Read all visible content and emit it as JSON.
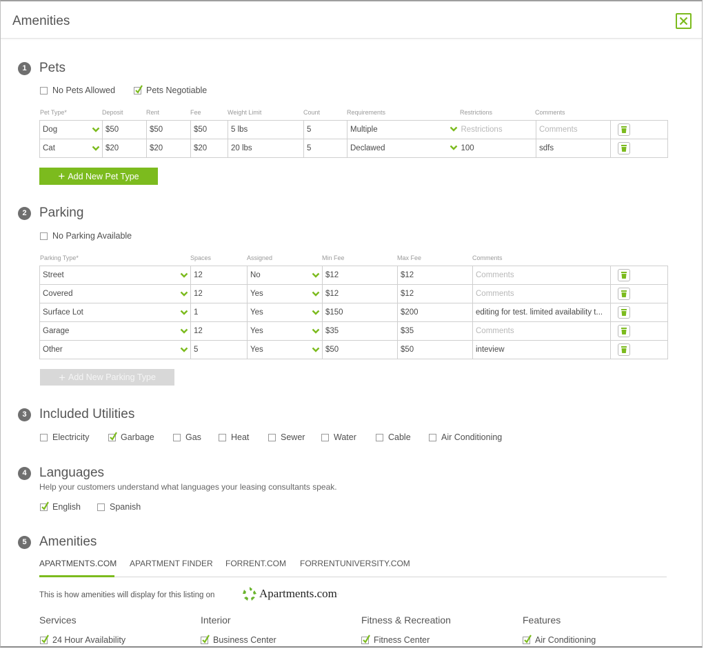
{
  "header": {
    "title": "Amenities",
    "close_icon": "close-x-icon"
  },
  "colors": {
    "accent": "#7cbb1e",
    "badge": "#6f6f6f",
    "border": "#cfcfcf",
    "placeholder": "#b8b8b8"
  },
  "pets": {
    "number": "1",
    "title": "Pets",
    "options": [
      {
        "label": "No Pets Allowed",
        "checked": false
      },
      {
        "label": "Pets Negotiable",
        "checked": true
      }
    ],
    "columns": [
      "Pet Type*",
      "Deposit",
      "Rent",
      "Fee",
      "Weight Limit",
      "Count",
      "Requirements",
      "Restrictions",
      "Comments"
    ],
    "rows": [
      {
        "type": "Dog",
        "deposit": "$50",
        "rent": "$50",
        "fee": "$50",
        "weight": "5 lbs",
        "count": "5",
        "requirements": "Multiple",
        "restrictions": "",
        "restrictions_placeholder": "Restrictions",
        "comments": "",
        "comments_placeholder": "Comments"
      },
      {
        "type": "Cat",
        "deposit": "$20",
        "rent": "$20",
        "fee": "$20",
        "weight": "20 lbs",
        "count": "5",
        "requirements": "Declawed",
        "restrictions": "100",
        "restrictions_placeholder": "Restrictions",
        "comments": "sdfs",
        "comments_placeholder": "Comments"
      }
    ],
    "add_label": "Add New Pet Type"
  },
  "parking": {
    "number": "2",
    "title": "Parking",
    "options": [
      {
        "label": "No Parking Available",
        "checked": false
      }
    ],
    "columns": [
      "Parking Type*",
      "Spaces",
      "Assigned",
      "Min Fee",
      "Max Fee",
      "Comments"
    ],
    "rows": [
      {
        "type": "Street",
        "spaces": "12",
        "assigned": "No",
        "min_fee": "$12",
        "max_fee": "$12",
        "comments": "",
        "comments_placeholder": "Comments"
      },
      {
        "type": "Covered",
        "spaces": "12",
        "assigned": "Yes",
        "min_fee": "$12",
        "max_fee": "$12",
        "comments": "",
        "comments_placeholder": "Comments"
      },
      {
        "type": "Surface Lot",
        "spaces": "1",
        "assigned": "Yes",
        "min_fee": "$150",
        "max_fee": "$200",
        "comments": "editing for test. limited availability t...",
        "comments_placeholder": "Comments"
      },
      {
        "type": "Garage",
        "spaces": "12",
        "assigned": "Yes",
        "min_fee": "$35",
        "max_fee": "$35",
        "comments": "",
        "comments_placeholder": "Comments"
      },
      {
        "type": "Other",
        "spaces": "5",
        "assigned": "Yes",
        "min_fee": "$50",
        "max_fee": "$50",
        "comments": "inteview",
        "comments_placeholder": "Comments"
      }
    ],
    "add_label": "Add New Parking Type",
    "add_disabled": true
  },
  "utilities": {
    "number": "3",
    "title": "Included Utilities",
    "options": [
      {
        "label": "Electricity",
        "checked": false
      },
      {
        "label": "Garbage",
        "checked": true
      },
      {
        "label": "Gas",
        "checked": false
      },
      {
        "label": "Heat",
        "checked": false
      },
      {
        "label": "Sewer",
        "checked": false
      },
      {
        "label": "Water",
        "checked": false
      },
      {
        "label": "Cable",
        "checked": false
      },
      {
        "label": "Air Conditioning",
        "checked": false
      }
    ]
  },
  "languages": {
    "number": "4",
    "title": "Languages",
    "helper": "Help your customers understand what languages your leasing consultants speak.",
    "options": [
      {
        "label": "English",
        "checked": true
      },
      {
        "label": "Spanish",
        "checked": false
      }
    ]
  },
  "amenities": {
    "number": "5",
    "title": "Amenities",
    "tabs": [
      {
        "label": "APARTMENTS.COM",
        "active": true
      },
      {
        "label": "APARTMENT FINDER",
        "active": false
      },
      {
        "label": "FORRENT.COM",
        "active": false
      },
      {
        "label": "FORRENTUNIVERSITY.COM",
        "active": false
      }
    ],
    "display_note": "This is how amenities will display for this listing on",
    "brand": {
      "name": "Apartments.com",
      "tm": "·",
      "icon": "apartments-logo-icon"
    },
    "categories": [
      {
        "title": "Services",
        "items": [
          {
            "label": "24 Hour Availability",
            "checked": true
          }
        ]
      },
      {
        "title": "Interior",
        "items": [
          {
            "label": "Business Center",
            "checked": true
          }
        ]
      },
      {
        "title": "Fitness & Recreation",
        "items": [
          {
            "label": "Fitness Center",
            "checked": true
          }
        ]
      },
      {
        "title": "Features",
        "items": [
          {
            "label": "Air Conditioning",
            "checked": true
          }
        ]
      }
    ]
  }
}
